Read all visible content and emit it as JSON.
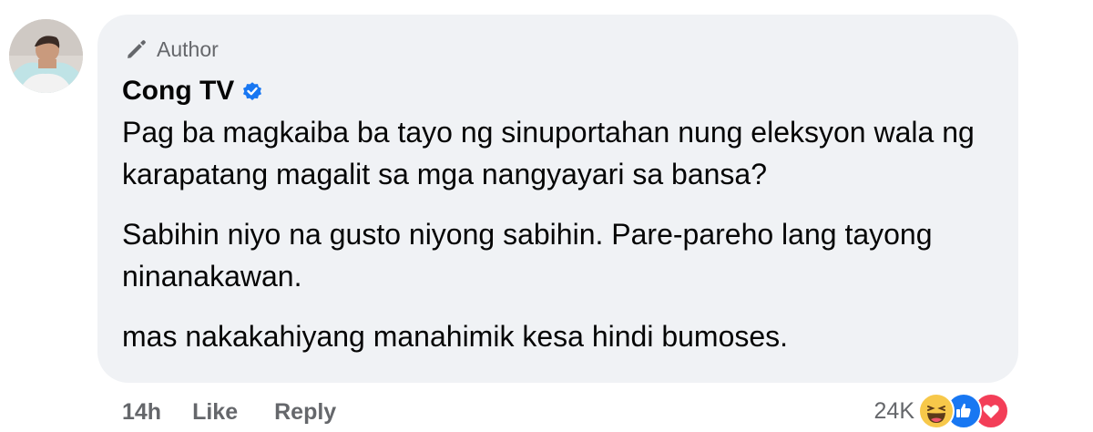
{
  "comment": {
    "author_badge": "Author",
    "author_name": "Cong TV",
    "verified": true,
    "paragraphs": [
      "Pag ba magkaiba ba tayo ng sinuportahan nung eleksyon wala ng karapatang magalit sa mga nangyayari sa bansa?",
      "Sabihin niyo na gusto niyong sabihin. Pare-pareho lang tayong ninanakawan.",
      "mas nakakahiyang manahimik kesa hindi bumoses."
    ],
    "time": "14h",
    "like_label": "Like",
    "reply_label": "Reply",
    "reaction_count": "24K",
    "reactions": [
      "haha-icon",
      "like-icon",
      "love-icon"
    ]
  },
  "colors": {
    "bubble": "#f0f2f5",
    "text": "#050505",
    "secondary": "#65676b",
    "verified": "#1877f2",
    "like": "#1877f2",
    "love": "#f33e58",
    "haha": "#f7c84a"
  }
}
